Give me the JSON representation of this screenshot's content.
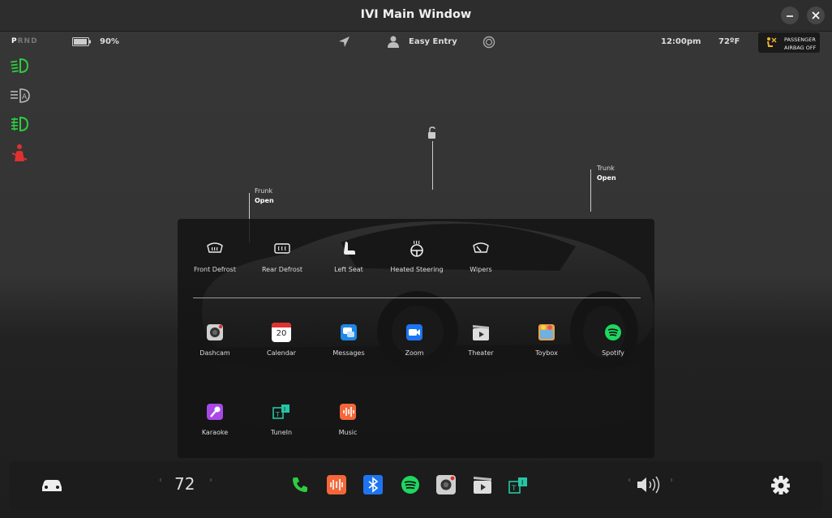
{
  "window": {
    "title": "IVI Main Window"
  },
  "status": {
    "gear": {
      "selected": "P",
      "others": "RND"
    },
    "battery": "90%",
    "profile": "Easy Entry",
    "time": "12:00pm",
    "temperature": "72ºF",
    "airbag": {
      "line1": "PASSENGER",
      "line2": "AIRBAG OFF"
    }
  },
  "car": {
    "frunk": {
      "label": "Frunk",
      "state": "Open"
    },
    "trunk": {
      "label": "Trunk",
      "state": "Open"
    }
  },
  "controls": [
    {
      "label": "Front Defrost",
      "icon": "front-defrost-icon"
    },
    {
      "label": "Rear Defrost",
      "icon": "rear-defrost-icon"
    },
    {
      "label": "Left Seat",
      "icon": "seat-icon"
    },
    {
      "label": "Heated Steering",
      "icon": "heated-steering-icon"
    },
    {
      "label": "Wipers",
      "icon": "wipers-icon"
    }
  ],
  "apps": [
    {
      "label": "Dashcam",
      "icon": "dashcam-icon"
    },
    {
      "label": "Calendar",
      "icon": "calendar-icon",
      "day": "20"
    },
    {
      "label": "Messages",
      "icon": "messages-icon"
    },
    {
      "label": "Zoom",
      "icon": "zoom-icon"
    },
    {
      "label": "Theater",
      "icon": "theater-icon"
    },
    {
      "label": "Toybox",
      "icon": "toybox-icon"
    },
    {
      "label": "Spotify",
      "icon": "spotify-icon"
    },
    {
      "label": "Karaoke",
      "icon": "karaoke-icon"
    },
    {
      "label": "TuneIn",
      "icon": "tunein-icon"
    },
    {
      "label": "Music",
      "icon": "music-icon"
    }
  ],
  "dock": {
    "temperature": "72"
  },
  "colors": {
    "accent_green": "#2ecc40",
    "alert_red": "#e03030",
    "zoom_blue": "#1e74f0",
    "music_orange": "#f5673a"
  }
}
